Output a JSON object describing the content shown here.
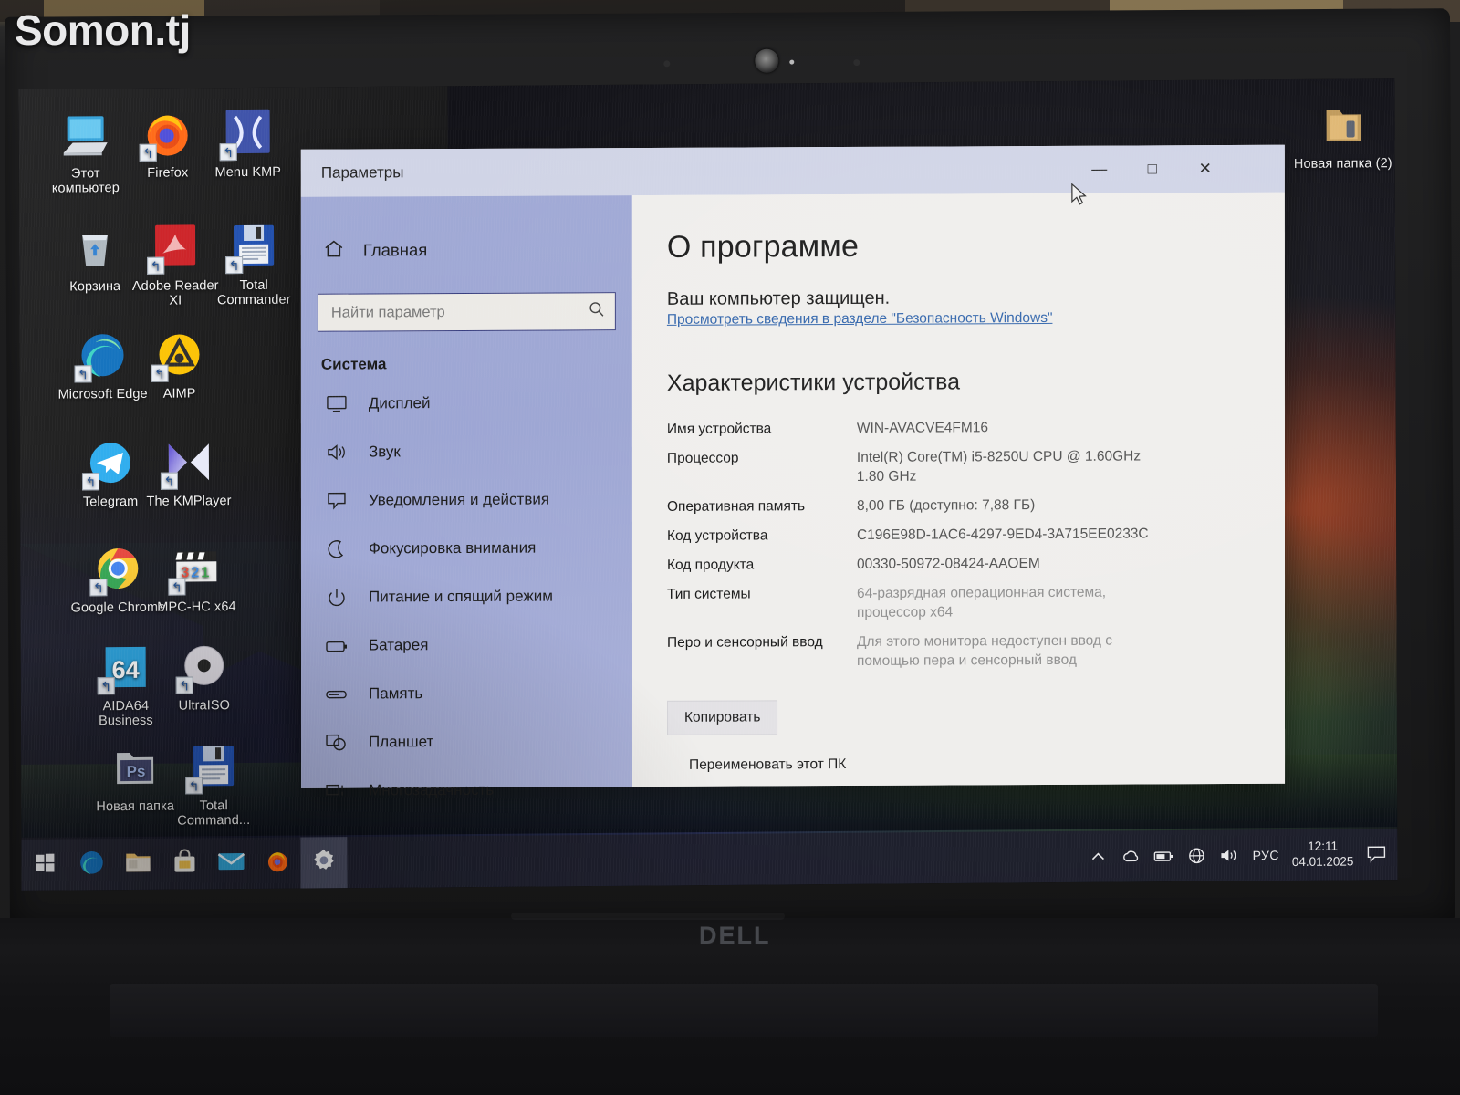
{
  "watermark": "Somon.tj",
  "laptop": {
    "brand": "DELL"
  },
  "desktop": {
    "icons": [
      {
        "name": "this-pc",
        "label": "Этот компьютер",
        "icon": "monitor-icon",
        "shortcut": false
      },
      {
        "name": "firefox",
        "label": "Firefox",
        "icon": "firefox-icon",
        "shortcut": true
      },
      {
        "name": "menu-kmp",
        "label": "Menu KMP",
        "icon": "kmp-menu-icon",
        "shortcut": true
      },
      {
        "name": "recycle-bin",
        "label": "Корзина",
        "icon": "recycle-bin-icon",
        "shortcut": false
      },
      {
        "name": "adobe-reader",
        "label": "Adobe Reader XI",
        "icon": "adobe-reader-icon",
        "shortcut": true
      },
      {
        "name": "total-commander",
        "label": "Total Commander",
        "icon": "floppy-disk-icon",
        "shortcut": true
      },
      {
        "name": "microsoft-edge",
        "label": "Microsoft Edge",
        "icon": "edge-icon",
        "shortcut": true
      },
      {
        "name": "aimp",
        "label": "AIMP",
        "icon": "aimp-icon",
        "shortcut": true
      },
      {
        "name": "telegram",
        "label": "Telegram",
        "icon": "telegram-icon",
        "shortcut": true
      },
      {
        "name": "kmplayer",
        "label": "The KMPlayer",
        "icon": "kmplayer-icon",
        "shortcut": true
      },
      {
        "name": "google-chrome",
        "label": "Google Chrome",
        "icon": "chrome-icon",
        "shortcut": true
      },
      {
        "name": "mpc-hc",
        "label": "MPC-HC x64",
        "icon": "clapperboard-icon",
        "shortcut": true
      },
      {
        "name": "aida64",
        "label": "AIDA64 Business",
        "icon": "aida64-icon",
        "shortcut": true
      },
      {
        "name": "ultraiso",
        "label": "UltraISO",
        "icon": "disc-icon",
        "shortcut": true
      },
      {
        "name": "new-folder",
        "label": "Новая папка",
        "icon": "folder-icon",
        "shortcut": false
      },
      {
        "name": "total-command-2",
        "label": "Total Command...",
        "icon": "floppy-disk-icon",
        "shortcut": true
      },
      {
        "name": "new-folder-2",
        "label": "Новая папка (2)",
        "icon": "folder-icon",
        "shortcut": false
      }
    ]
  },
  "window": {
    "title": "Параметры",
    "controls": {
      "minimize": "—",
      "maximize": "□",
      "close": "✕"
    }
  },
  "sidebar": {
    "home_label": "Главная",
    "search_placeholder": "Найти параметр",
    "search_value": "",
    "group_label": "Система",
    "items": [
      {
        "label": "Дисплей",
        "icon": "display-icon"
      },
      {
        "label": "Звук",
        "icon": "sound-icon"
      },
      {
        "label": "Уведомления и действия",
        "icon": "notification-icon"
      },
      {
        "label": "Фокусировка внимания",
        "icon": "moon-icon"
      },
      {
        "label": "Питание и спящий режим",
        "icon": "power-icon"
      },
      {
        "label": "Батарея",
        "icon": "battery-icon"
      },
      {
        "label": "Память",
        "icon": "storage-icon"
      },
      {
        "label": "Планшет",
        "icon": "tablet-icon"
      },
      {
        "label": "Многозадачность",
        "icon": "multitasking-icon"
      }
    ]
  },
  "content": {
    "heading": "О программе",
    "protection_status": "Ваш компьютер защищен.",
    "security_link": "Просмотреть сведения в разделе \"Безопасность Windows\"",
    "specs_heading": "Характеристики устройства",
    "specs": [
      {
        "key": "Имя устройства",
        "value": "WIN-AVACVE4FM16",
        "dim": false
      },
      {
        "key": "Процессор",
        "value": "Intel(R) Core(TM) i5-8250U CPU @ 1.60GHz 1.80 GHz",
        "dim": false
      },
      {
        "key": "Оперативная память",
        "value": "8,00 ГБ (доступно: 7,88 ГБ)",
        "dim": false
      },
      {
        "key": "Код устройства",
        "value": "C196E98D-1AC6-4297-9ED4-3A715EE0233C",
        "dim": false
      },
      {
        "key": "Код продукта",
        "value": "00330-50972-08424-AAOEM",
        "dim": false
      },
      {
        "key": "Тип системы",
        "value": "64-разрядная операционная система, процессор x64",
        "dim": true
      },
      {
        "key": "Перо и сенсорный ввод",
        "value": "Для этого монитора недоступен ввод с помощью пера и сенсорный ввод",
        "dim": true
      }
    ],
    "copy_button": "Копировать",
    "rename_button": "Переименовать этот ПК"
  },
  "taskbar": {
    "buttons": [
      {
        "name": "start-button",
        "icon": "windows-logo-icon",
        "active": false
      },
      {
        "name": "edge-taskbar",
        "icon": "edge-icon",
        "active": false
      },
      {
        "name": "file-explorer",
        "icon": "folder-icon",
        "active": false
      },
      {
        "name": "microsoft-store",
        "icon": "store-bag-icon",
        "active": false
      },
      {
        "name": "mail-app",
        "icon": "envelope-icon",
        "active": false
      },
      {
        "name": "firefox-taskbar",
        "icon": "firefox-icon",
        "active": false
      },
      {
        "name": "settings-taskbar",
        "icon": "gear-icon",
        "active": true
      }
    ],
    "tray": [
      {
        "name": "show-hidden-icons",
        "icon": "chevron-up-icon",
        "glyph": "⌃"
      },
      {
        "name": "onedrive-tray",
        "icon": "cloud-icon",
        "glyph": "☁"
      },
      {
        "name": "battery-tray",
        "icon": "battery-icon",
        "glyph": "▭"
      },
      {
        "name": "network-tray",
        "icon": "globe-icon",
        "glyph": "⊕"
      },
      {
        "name": "volume-tray",
        "icon": "speaker-icon",
        "glyph": "🔊"
      }
    ],
    "language": "РУС",
    "clock_time": "12:11",
    "clock_date": "04.01.2025",
    "action_center_icon": "speech-bubble-icon"
  },
  "colors": {
    "accent_link": "#2a5fa8",
    "sidebar_bg": "#9ea7d4",
    "titlebar_bg": "#cfd3e6",
    "content_bg": "#efeeec"
  }
}
